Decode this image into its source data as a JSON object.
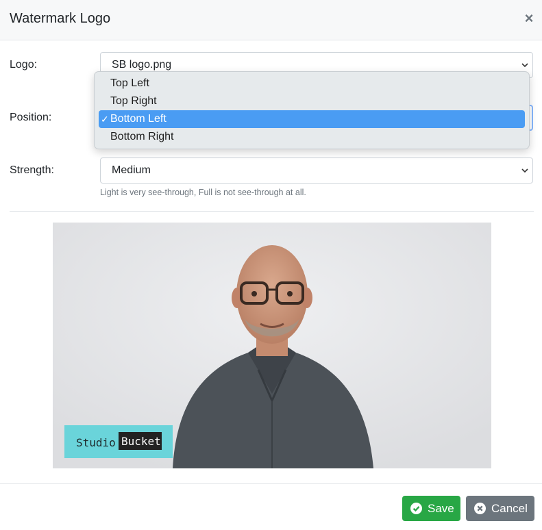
{
  "modal": {
    "title": "Watermark Logo"
  },
  "form": {
    "logo": {
      "label": "Logo:",
      "value": "SB logo.png"
    },
    "position": {
      "label": "Position:",
      "options": [
        "Top Left",
        "Top Right",
        "Bottom Left",
        "Bottom Right"
      ],
      "selected_index": 2,
      "check": "✓"
    },
    "strength": {
      "label": "Strength:",
      "value": "Medium",
      "help": "Light is very see-through, Full is not see-through at all."
    }
  },
  "preview": {
    "watermark_parts": [
      "Studio",
      "Bucket"
    ]
  },
  "footer": {
    "save_label": "Save",
    "cancel_label": "Cancel"
  },
  "colors": {
    "save": "#28a745",
    "cancel": "#6c757d",
    "selected": "#4a9cf3",
    "watermark": "#5fd3d9"
  },
  "icons": [
    "close-icon",
    "chevron-down-icon",
    "check-circle-icon",
    "times-circle-icon"
  ]
}
